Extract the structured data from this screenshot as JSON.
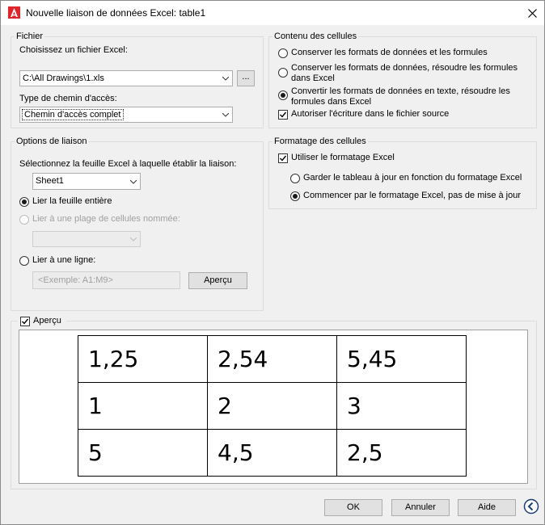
{
  "window": {
    "title": "Nouvelle liaison de données Excel: table1"
  },
  "fichier": {
    "legend": "Fichier",
    "choose_label": "Choisissez un fichier Excel:",
    "file_value": "C:\\All Drawings\\1.xls",
    "browse_label": "...",
    "path_type_label": "Type de chemin d'accès:",
    "path_type_value": "Chemin d'accès complet"
  },
  "options": {
    "legend": "Options de liaison",
    "sheet_label": "Sélectionnez la feuille Excel à laquelle établir la liaison:",
    "sheet_value": "Sheet1",
    "radio_whole": "Lier la feuille entière",
    "radio_named": "Lier à une plage de cellules nommée:",
    "radio_range": "Lier à une ligne:",
    "range_placeholder": "<Exemple: A1:M9>",
    "preview_button": "Aperçu"
  },
  "contenu": {
    "legend": "Contenu des cellules",
    "opt1": "Conserver les formats de données et les formules",
    "opt2_line1": "Conserver les formats de données, résoudre les formules",
    "opt2_line2": "dans Excel",
    "opt3_line1": "Convertir les formats de données en texte, résoudre les",
    "opt3_line2": "formules dans Excel",
    "allow_write": "Autoriser l'écriture dans le fichier source"
  },
  "formatage": {
    "legend": "Formatage des cellules",
    "use_excel": "Utiliser le formatage Excel",
    "keep_updated": "Garder le tableau à jour en fonction du formatage Excel",
    "start_with": "Commencer par le formatage Excel, pas de mise à jour"
  },
  "preview": {
    "label": "Aperçu",
    "rows": [
      [
        "1,25",
        "2,54",
        "5,45"
      ],
      [
        "1",
        "2",
        "3"
      ],
      [
        "5",
        "4,5",
        "2,5"
      ]
    ]
  },
  "buttons": {
    "ok": "OK",
    "cancel": "Annuler",
    "help": "Aide"
  }
}
